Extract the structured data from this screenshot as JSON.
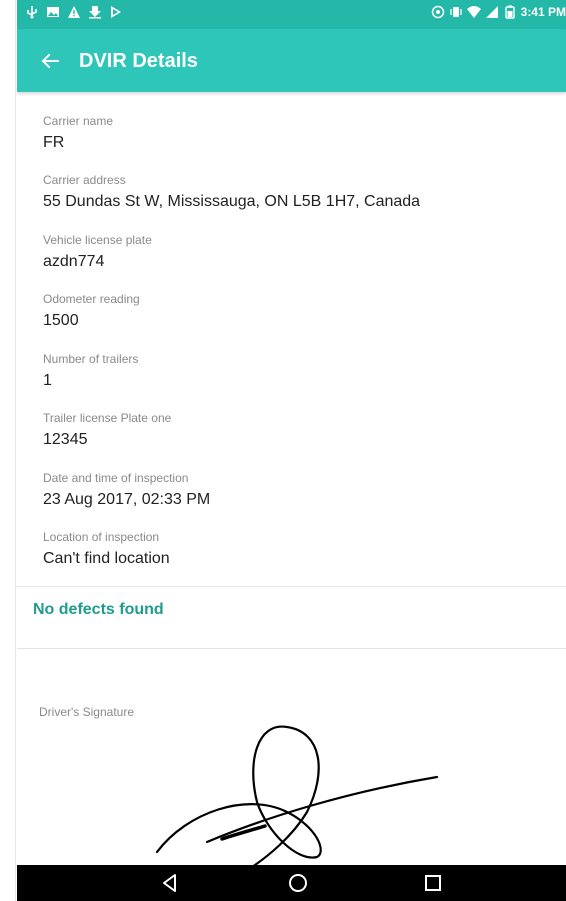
{
  "status_bar": {
    "time": "3:41 PM",
    "left_icons": [
      "usb-icon",
      "image-icon",
      "warning-icon",
      "download-icon",
      "play-store-icon"
    ],
    "right_icons": [
      "sync-icon",
      "vibrate-icon",
      "wifi-icon",
      "signal-icon",
      "battery-icon"
    ]
  },
  "app_bar": {
    "title": "DVIR Details",
    "back_icon": "arrow-back-icon"
  },
  "fields": [
    {
      "label": "Carrier name",
      "value": "FR"
    },
    {
      "label": "Carrier address",
      "value": "55 Dundas St W, Mississauga, ON L5B 1H7, Canada"
    },
    {
      "label": "Vehicle license plate",
      "value": "azdn774"
    },
    {
      "label": "Odometer reading",
      "value": "1500"
    },
    {
      "label": "Number of trailers",
      "value": "1"
    },
    {
      "label": "Trailer license Plate one",
      "value": "12345"
    },
    {
      "label": "Date and time of inspection",
      "value": "23 Aug 2017, 02:33 PM"
    },
    {
      "label": "Location of inspection",
      "value": "Can't find location"
    }
  ],
  "defects": {
    "text": "No defects found"
  },
  "signature": {
    "label": "Driver's Signature"
  },
  "colors": {
    "status_bar": "#24b8a8",
    "app_bar": "#2dc6b8",
    "accent_text": "#1f9c8e",
    "label_gray": "#8a8a8a",
    "value_text": "#222222"
  },
  "nav_bar": {
    "icons": [
      "nav-back-icon",
      "nav-home-icon",
      "nav-recents-icon"
    ]
  }
}
